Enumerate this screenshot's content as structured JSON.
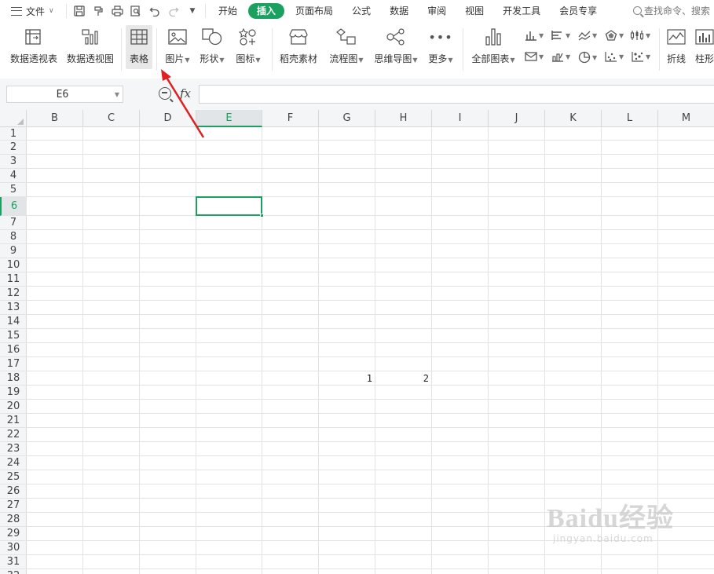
{
  "menubar": {
    "file_label": "文件",
    "tabs": [
      {
        "label": "开始",
        "active": false
      },
      {
        "label": "插入",
        "active": true
      },
      {
        "label": "页面布局",
        "active": false
      },
      {
        "label": "公式",
        "active": false
      },
      {
        "label": "数据",
        "active": false
      },
      {
        "label": "审阅",
        "active": false
      },
      {
        "label": "视图",
        "active": false
      },
      {
        "label": "开发工具",
        "active": false
      },
      {
        "label": "会员专享",
        "active": false
      }
    ],
    "search_placeholder": "查找命令、搜索",
    "accent_color": "#1aa15f"
  },
  "ribbon": {
    "pivot_table": "数据透视表",
    "pivot_chart": "数据透视图",
    "table": "表格",
    "picture": "图片",
    "shape": "形状",
    "icon": "图标",
    "docer_material": "稻壳素材",
    "flowchart": "流程图",
    "mindmap": "思维导图",
    "more": "更多",
    "all_charts": "全部图表",
    "line": "折线",
    "column": "柱形"
  },
  "formula_bar": {
    "name_box": "E6",
    "fx_label": "fx",
    "value": ""
  },
  "sheet": {
    "columns": [
      "B",
      "C",
      "D",
      "E",
      "F",
      "G",
      "H",
      "I",
      "J",
      "K",
      "L",
      "M"
    ],
    "selected_column": "E",
    "rows": [
      "1",
      "2",
      "3",
      "4",
      "5",
      "6",
      "7",
      "8",
      "9",
      "10",
      "11",
      "12",
      "13",
      "14",
      "15",
      "16",
      "17",
      "18",
      "19",
      "20",
      "21",
      "22",
      "23",
      "24",
      "25",
      "26",
      "27",
      "28",
      "29",
      "30",
      "31",
      "32"
    ],
    "selected_row": "6",
    "selected_cell": "E6",
    "values": [
      {
        "cell": "G18",
        "value": "1"
      },
      {
        "cell": "H18",
        "value": "2"
      }
    ]
  },
  "watermark": {
    "brand": "Baidu经验",
    "url": "jingyan.baidu.com"
  }
}
